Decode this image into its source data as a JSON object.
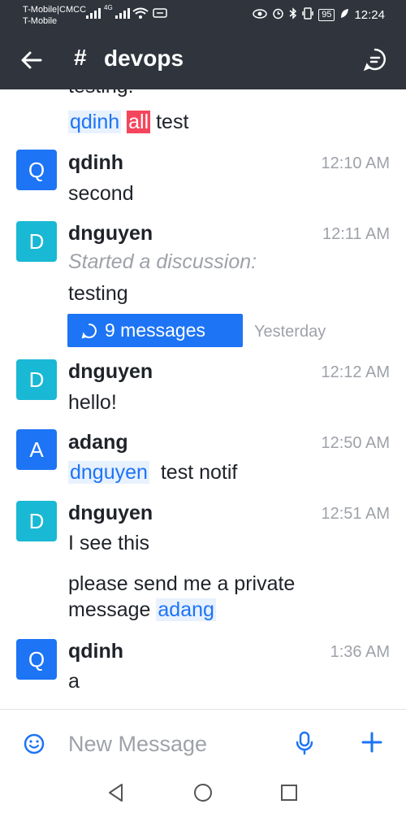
{
  "status_bar": {
    "carrier_primary": "T-Mobile|CMCC",
    "carrier_secondary": "T-Mobile",
    "network": "4G",
    "battery": "95",
    "time": "12:24"
  },
  "header": {
    "channel_prefix": "#",
    "channel_name": "devops"
  },
  "messages": {
    "cut_off_text": "testing!",
    "first_line": {
      "mention_user": "qdinh",
      "mention_all": "all",
      "text": "test"
    },
    "items": [
      {
        "avatar_letter": "Q",
        "user": "qdinh",
        "time": "12:10 AM",
        "text": "second"
      },
      {
        "avatar_letter": "D",
        "user": "dnguyen",
        "time": "12:11 AM",
        "system": "Started a discussion:",
        "text": "testing",
        "thread": {
          "label": "9 messages",
          "when": "Yesterday"
        }
      },
      {
        "avatar_letter": "D",
        "user": "dnguyen",
        "time": "12:12 AM",
        "text": "hello!"
      },
      {
        "avatar_letter": "A",
        "user": "adang",
        "time": "12:50 AM",
        "mention": "dnguyen",
        "text": "test notif"
      },
      {
        "avatar_letter": "D",
        "user": "dnguyen",
        "time": "12:51 AM",
        "text": "I see this",
        "followup_line1": "please send me a private",
        "followup_line2_prefix": "message",
        "followup_mention": "adang"
      },
      {
        "avatar_letter": "Q",
        "user": "qdinh",
        "time": "1:36 AM",
        "text": "a"
      }
    ]
  },
  "composer": {
    "placeholder": "New Message"
  },
  "colors": {
    "header_bg": "#2f343d",
    "accent": "#1d74f5",
    "avatar_teal": "#19b8d4",
    "mention_all_bg": "#f5455c",
    "muted_text": "#9ea2a8"
  }
}
